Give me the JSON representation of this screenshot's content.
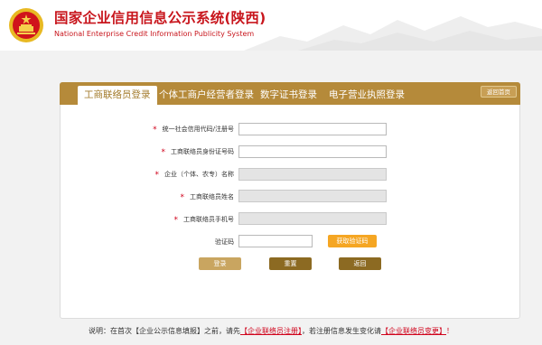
{
  "header": {
    "title": "国家企业信用信息公示系统(陕西)",
    "subtitle": "National Enterprise Credit Information Publicity System"
  },
  "tabs": [
    {
      "label": "工商联络员登录",
      "active": true
    },
    {
      "label": "个体工商户经营者登录",
      "active": false
    },
    {
      "label": "数字证书登录",
      "active": false
    },
    {
      "label": "电子营业执照登录",
      "active": false
    }
  ],
  "home_button": "返回首页",
  "form": {
    "required_mark": "*",
    "fields": [
      {
        "label": "统一社会信用代码/注册号",
        "value": "",
        "enabled": true,
        "required": true
      },
      {
        "label": "工商联络员身份证号码",
        "value": "",
        "enabled": true,
        "required": true
      },
      {
        "label": "企业（个体、农专）名称",
        "value": "",
        "enabled": false,
        "required": true
      },
      {
        "label": "工商联络员姓名",
        "value": "",
        "enabled": false,
        "required": true
      },
      {
        "label": "工商联络员手机号",
        "value": "",
        "enabled": false,
        "required": true
      }
    ],
    "captcha_label": "验证码",
    "captcha_value": "",
    "sms_button": "获取验证码",
    "login_button": "登录",
    "reset_button": "重置",
    "back_button": "返回"
  },
  "notice": {
    "prefix": "说明：在首次【企业公示信息填报】之前，请先",
    "link1": "【企业联络员注册】",
    "middle": "，若注册信息发生变化请",
    "link2": "【企业联络员变更】",
    "suffix": "！"
  },
  "colors": {
    "brand_red": "#c8161d",
    "tab_gold": "#b58a3a",
    "button_brown": "#8c6a22",
    "sms_orange": "#f5a623"
  }
}
